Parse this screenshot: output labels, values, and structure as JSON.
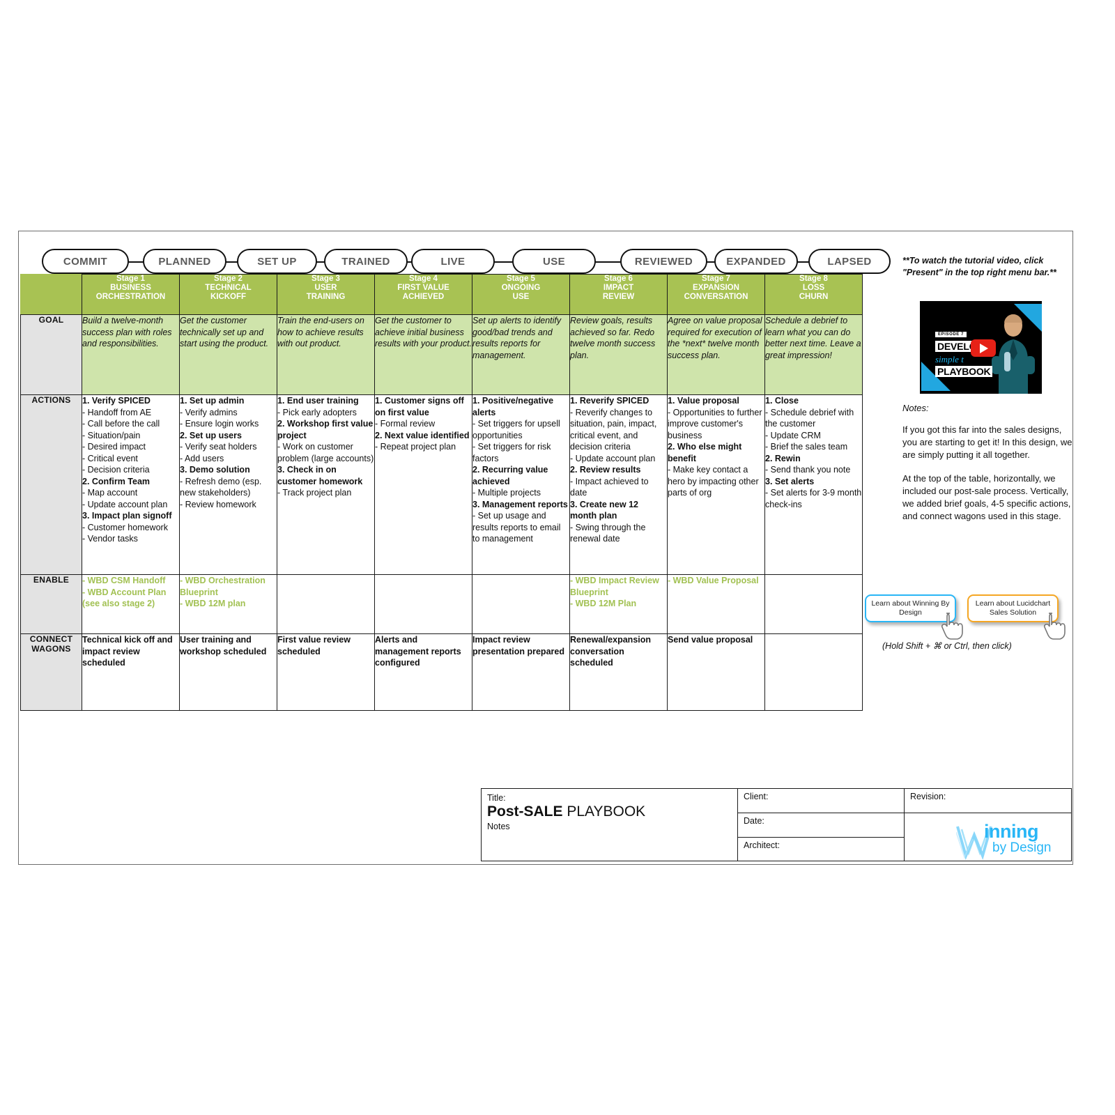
{
  "stage_pills": [
    "COMMIT",
    "PLANNED",
    "SET UP",
    "TRAINED",
    "LIVE",
    "USE",
    "REVIEWED",
    "EXPANDED",
    "LAPSED"
  ],
  "row_labels": {
    "corner": "",
    "goal": "GOAL",
    "actions": "ACTIONS",
    "enable": "ENABLE",
    "connect_wagons": "CONNECT WAGONS"
  },
  "columns": [
    {
      "stage": "Stage 1",
      "name_line1": "BUSINESS",
      "name_line2": "ORCHESTRATION"
    },
    {
      "stage": "Stage 2",
      "name_line1": "TECHNICAL",
      "name_line2": "KICKOFF"
    },
    {
      "stage": "Stage 3",
      "name_line1": "USER",
      "name_line2": "TRAINING"
    },
    {
      "stage": "Stage 4",
      "name_line1": "FIRST VALUE",
      "name_line2": "ACHIEVED"
    },
    {
      "stage": "Stage 5",
      "name_line1": "ONGOING",
      "name_line2": "USE"
    },
    {
      "stage": "Stage 6",
      "name_line1": "IMPACT",
      "name_line2": "REVIEW"
    },
    {
      "stage": "Stage 7",
      "name_line1": "EXPANSION",
      "name_line2": "CONVERSATION"
    },
    {
      "stage": "Stage 8",
      "name_line1": "LOSS",
      "name_line2": "CHURN"
    }
  ],
  "goal": [
    "Build a twelve-month success plan with roles and responsibilities.",
    "Get the customer technically set up and start using the product.",
    "Train the end-users on how to achieve results with out product.",
    "Get the customer to achieve initial business results with your product.",
    "Set up alerts to identify good/bad trends and results reports for management.",
    "Review goals, results achieved so far. Redo twelve month success plan.",
    "Agree on value proposal required for execution of the *next* twelve month success plan.",
    "Schedule a debrief to learn what you can do better next time. Leave a great impression!"
  ],
  "actions": [
    [
      {
        "t": "1. Verify SPICED",
        "b": true
      },
      {
        "t": "- Handoff from AE",
        "b": false
      },
      {
        "t": "- Call before the call",
        "b": false
      },
      {
        "t": "- Situation/pain",
        "b": false
      },
      {
        "t": "- Desired impact",
        "b": false
      },
      {
        "t": "- Critical event",
        "b": false
      },
      {
        "t": "- Decision criteria",
        "b": false
      },
      {
        "t": "2. Confirm Team",
        "b": true
      },
      {
        "t": "- Map account",
        "b": false
      },
      {
        "t": "- Update account plan",
        "b": false
      },
      {
        "t": "3. Impact plan signoff",
        "b": true
      },
      {
        "t": "- Customer homework",
        "b": false
      },
      {
        "t": "- Vendor tasks",
        "b": false
      }
    ],
    [
      {
        "t": "1. Set up admin",
        "b": true
      },
      {
        "t": "- Verify admins",
        "b": false
      },
      {
        "t": "- Ensure login works",
        "b": false
      },
      {
        "t": "2. Set up users",
        "b": true
      },
      {
        "t": "- Verify seat holders",
        "b": false
      },
      {
        "t": "- Add users",
        "b": false
      },
      {
        "t": "3. Demo solution",
        "b": true
      },
      {
        "t": "- Refresh demo (esp. new stakeholders)",
        "b": false
      },
      {
        "t": "- Review homework",
        "b": false
      }
    ],
    [
      {
        "t": "1. End user training",
        "b": true
      },
      {
        "t": "- Pick early adopters",
        "b": false
      },
      {
        "t": "2. Workshop first value project",
        "b": true
      },
      {
        "t": "- Work on customer problem (large accounts)",
        "b": false
      },
      {
        "t": "3. Check in on customer homework",
        "b": true
      },
      {
        "t": "- Track project plan",
        "b": false
      }
    ],
    [
      {
        "t": "1. Customer signs off on first value",
        "b": true
      },
      {
        "t": "- Formal review",
        "b": false
      },
      {
        "t": "2. Next value identified",
        "b": true
      },
      {
        "t": "- Repeat project plan",
        "b": false
      }
    ],
    [
      {
        "t": "1. Positive/negative alerts",
        "b": true
      },
      {
        "t": "- Set triggers for upsell opportunities",
        "b": false
      },
      {
        "t": "- Set triggers for risk factors",
        "b": false
      },
      {
        "t": "2. Recurring value achieved",
        "b": true
      },
      {
        "t": "- Multiple projects",
        "b": false
      },
      {
        "t": "3. Management reports",
        "b": true
      },
      {
        "t": "- Set up usage and results reports to email to management",
        "b": false
      }
    ],
    [
      {
        "t": "1. Reverify SPICED",
        "b": true
      },
      {
        "t": "- Reverify changes to situation, pain, impact, critical event, and decision criteria",
        "b": false
      },
      {
        "t": "- Update account plan",
        "b": false
      },
      {
        "t": "2. Review results",
        "b": true
      },
      {
        "t": "- Impact achieved to date",
        "b": false
      },
      {
        "t": "3. Create new 12 month plan",
        "b": true
      },
      {
        "t": "- Swing through the renewal date",
        "b": false
      }
    ],
    [
      {
        "t": "1. Value proposal",
        "b": true
      },
      {
        "t": "- Opportunities to further improve customer's business",
        "b": false
      },
      {
        "t": "2. Who else might benefit",
        "b": true
      },
      {
        "t": "- Make key contact a hero by impacting other parts of org",
        "b": false
      }
    ],
    [
      {
        "t": "1. Close",
        "b": true
      },
      {
        "t": "- Schedule debrief with the customer",
        "b": false
      },
      {
        "t": "- Update CRM",
        "b": false
      },
      {
        "t": "- Brief the sales team",
        "b": false
      },
      {
        "t": "2. Rewin",
        "b": true
      },
      {
        "t": "- Send thank you note",
        "b": false
      },
      {
        "t": "3. Set alerts",
        "b": true
      },
      {
        "t": "- Set alerts for 3-9 month check-ins",
        "b": false
      }
    ]
  ],
  "enable": [
    [
      "- WBD CSM Handoff",
      "- WBD Account Plan (see also stage 2)"
    ],
    [
      "- WBD Orchestration Blueprint",
      "- WBD 12M plan"
    ],
    [],
    [],
    [],
    [
      "- WBD Impact Review Blueprint",
      "- WBD 12M Plan"
    ],
    [
      "- WBD Value Proposal"
    ],
    []
  ],
  "connect_wagons": [
    "Technical kick off and impact review scheduled",
    "User training and workshop scheduled",
    "First value review scheduled",
    "Alerts and management reports configured",
    "Impact review presentation prepared",
    "Renewal/expansion conversation scheduled",
    "Send value proposal",
    ""
  ],
  "sidebar": {
    "tutorial_note": "**To watch the tutorial video, click \"Present\" in the top right menu bar.**",
    "video": {
      "episode": "EPISODE 7",
      "line1": "DEVELOP A",
      "line2": "simple t",
      "line3": "PLAYBOOK"
    },
    "notes_label": "Notes:",
    "notes_p1": "If you got this far into the sales designs, you are starting to get it! In this design, we are simply putting it all together.",
    "notes_p2": "At the top of the table, horizontally, we included our post-sale process. Vertically, we added brief goals, 4-5 specific actions, and connect wagons used in this stage.",
    "button_wbd": "Learn about Winning By Design",
    "button_lucidchart": "Learn about Lucidchart Sales Solution",
    "hold_note": "(Hold Shift + ⌘ or Ctrl, then click)"
  },
  "title_block": {
    "title_label": "Title:",
    "title_bold": "Post-SALE",
    "title_rest": " PLAYBOOK",
    "subtitle": "Notes",
    "client_label": "Client:",
    "date_label": "Date:",
    "architect_label": "Architect:",
    "revision_label": "Revision:",
    "logo_w": "W",
    "logo_inning": "inning",
    "logo_by": "by Design"
  },
  "colors": {
    "header_green": "#a8c253",
    "goal_green": "#cfe4ab",
    "enable_green_text": "#a2c153",
    "row_label_grey": "#e3e3e3",
    "brand_blue": "#29b6f6",
    "accent_orange": "#f5a623"
  }
}
